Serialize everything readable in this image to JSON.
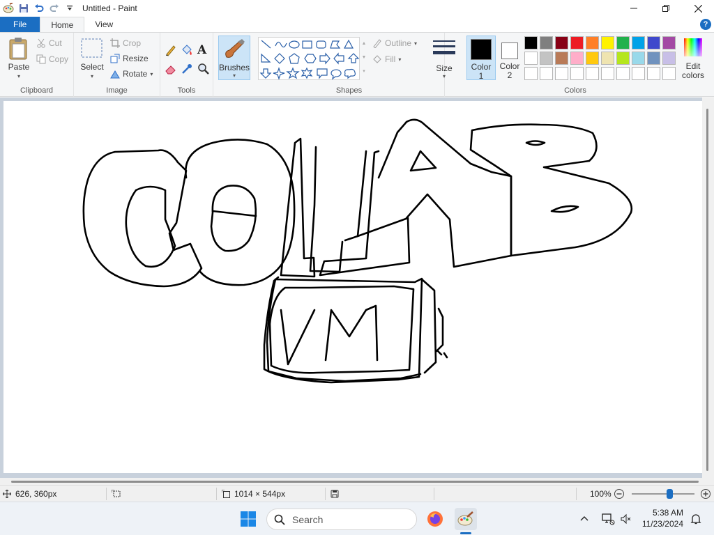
{
  "window": {
    "title": "Untitled - Paint"
  },
  "tabs": [
    "File",
    "Home",
    "View"
  ],
  "clipboard": {
    "paste": "Paste",
    "cut": "Cut",
    "copy": "Copy",
    "label": "Clipboard"
  },
  "image": {
    "select": "Select",
    "crop": "Crop",
    "resize": "Resize",
    "rotate": "Rotate",
    "label": "Image"
  },
  "tools": {
    "label": "Tools"
  },
  "brushes": {
    "label": "Brushes"
  },
  "shapes": {
    "outline": "Outline",
    "fill": "Fill",
    "label": "Shapes"
  },
  "size": {
    "label": "Size"
  },
  "colors": {
    "color1_label": "Color",
    "color1_num": "1",
    "color2_label": "Color",
    "color2_num": "2",
    "color1": "#000000",
    "color2": "#ffffff",
    "edit_line1": "Edit",
    "edit_line2": "colors",
    "label": "Colors",
    "palette_row1": [
      "#000000",
      "#7f7f7f",
      "#880015",
      "#ed1c24",
      "#ff7f27",
      "#fff200",
      "#22b14c",
      "#00a2e8",
      "#3f48cc",
      "#a349a4"
    ],
    "palette_row2": [
      "#ffffff",
      "#c3c3c3",
      "#b97a57",
      "#ffaec9",
      "#ffc90e",
      "#efe4b0",
      "#b5e61d",
      "#99d9ea",
      "#7092be",
      "#c8bfe7"
    ],
    "palette_row3": [
      "#ffffff",
      "#ffffff",
      "#ffffff",
      "#ffffff",
      "#ffffff",
      "#ffffff",
      "#ffffff",
      "#ffffff",
      "#ffffff",
      "#ffffff"
    ]
  },
  "status": {
    "cursor": "626, 360px",
    "canvas_size": "1014 × 544px",
    "zoom": "100%",
    "zoom_fraction": 0.6
  },
  "taskbar": {
    "search_placeholder": "Search",
    "time": "5:38 AM",
    "date": "11/23/2024"
  }
}
